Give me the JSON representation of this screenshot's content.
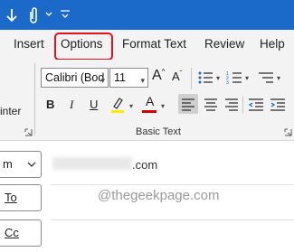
{
  "colors": {
    "titlebar": "#1b6ac9",
    "ribbon": "#f3f3f3",
    "highlight": "#e3101e",
    "text_highlight_yellow": "#ffeb00",
    "font_color_red": "#d40000"
  },
  "quick_access": {
    "icons": [
      "down-arrow-icon",
      "attach-icon",
      "chevron-down-icon",
      "customize-icon"
    ]
  },
  "tabs": [
    {
      "label": "Insert"
    },
    {
      "label": "Options"
    },
    {
      "label": "Format Text"
    },
    {
      "label": "Review"
    },
    {
      "label": "Help"
    }
  ],
  "ribbon": {
    "font_name": "Calibri (Bod",
    "font_size": "11",
    "grow_font": "A",
    "shrink_font": "A",
    "bold": "B",
    "italic": "I",
    "font_color_letter": "A",
    "group_label": "Basic Text",
    "left_group_label": "inter"
  },
  "compose": {
    "from_label": "m",
    "to_label": "To",
    "cc_label": "Cc",
    "from_email_suffix": ".com",
    "watermark": "@thegeekpage.com"
  }
}
